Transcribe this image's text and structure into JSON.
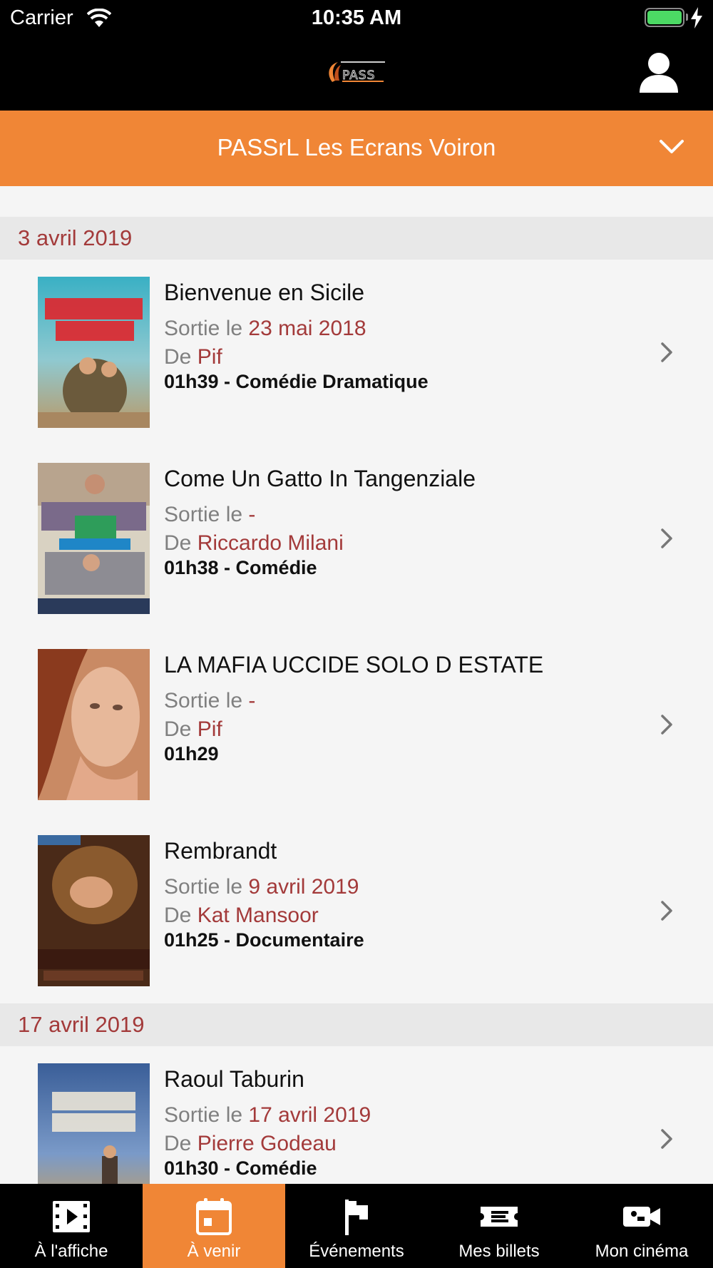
{
  "status_bar": {
    "carrier": "Carrier",
    "time": "10:35 AM"
  },
  "header": {
    "logo_icon": "pass-logo",
    "user_icon": "user-icon"
  },
  "cinema_selector": {
    "name": "PASSrL Les Ecrans Voiron"
  },
  "labels": {
    "release_prefix": "Sortie le ",
    "director_prefix": "De "
  },
  "sections": [
    {
      "date": "3 avril 2019",
      "movies": [
        {
          "title": "Bienvenue en Sicile",
          "release": "23 mai 2018",
          "director": "Pif",
          "meta": "01h39 - Comédie Dramatique"
        },
        {
          "title": "Come Un Gatto In Tangenziale",
          "release": "-",
          "director": "Riccardo Milani",
          "meta": "01h38 - Comédie"
        },
        {
          "title": "LA MAFIA UCCIDE SOLO D ESTATE",
          "release": "-",
          "director": "Pif",
          "meta": "01h29"
        },
        {
          "title": "Rembrandt",
          "release": "9 avril 2019",
          "director": "Kat Mansoor",
          "meta": "01h25 - Documentaire"
        }
      ]
    },
    {
      "date": "17 avril 2019",
      "movies": [
        {
          "title": "Raoul Taburin",
          "release": "17 avril 2019",
          "director": "Pierre Godeau",
          "meta": "01h30 - Comédie"
        }
      ]
    }
  ],
  "tabs": [
    {
      "label": "À l'affiche",
      "icon": "film-icon",
      "active": false
    },
    {
      "label": "À venir",
      "icon": "calendar-icon",
      "active": true
    },
    {
      "label": "Événements",
      "icon": "flag-icon",
      "active": false
    },
    {
      "label": "Mes billets",
      "icon": "ticket-icon",
      "active": false
    },
    {
      "label": "Mon cinéma",
      "icon": "camera-icon",
      "active": false
    }
  ],
  "colors": {
    "accent": "#f08636",
    "date_red": "#a33a3a",
    "bar_black": "#000000"
  }
}
